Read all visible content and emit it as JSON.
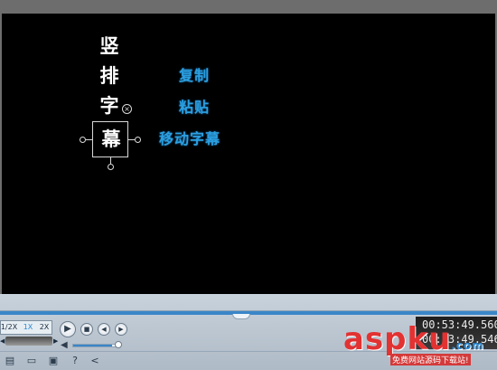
{
  "subtitle": {
    "vertical_chars": [
      "竖",
      "排",
      "字",
      "幕"
    ]
  },
  "context_menu": {
    "items": [
      "复制",
      "粘贴",
      "移动字幕"
    ]
  },
  "playback": {
    "speeds": [
      "1/2X",
      "1X",
      "2X"
    ],
    "active_speed": "1X",
    "progress_percent": 100,
    "volume_percent": 85
  },
  "time": {
    "current": "00:53:49.560",
    "total": "00:53:49.546"
  },
  "watermark": {
    "text": "aspku",
    "tld": ".com",
    "sub": "免费网站源码下载站!"
  },
  "colors": {
    "accent": "#2a8ad6",
    "context_text": "#2b9fe0",
    "video_bg": "#000000",
    "watermark": "#e23232"
  },
  "icons": [
    "play-icon",
    "stop-icon",
    "prev-icon",
    "next-icon",
    "volume-icon",
    "new-file-icon",
    "open-folder-icon",
    "save-icon",
    "help-icon",
    "share-icon"
  ]
}
